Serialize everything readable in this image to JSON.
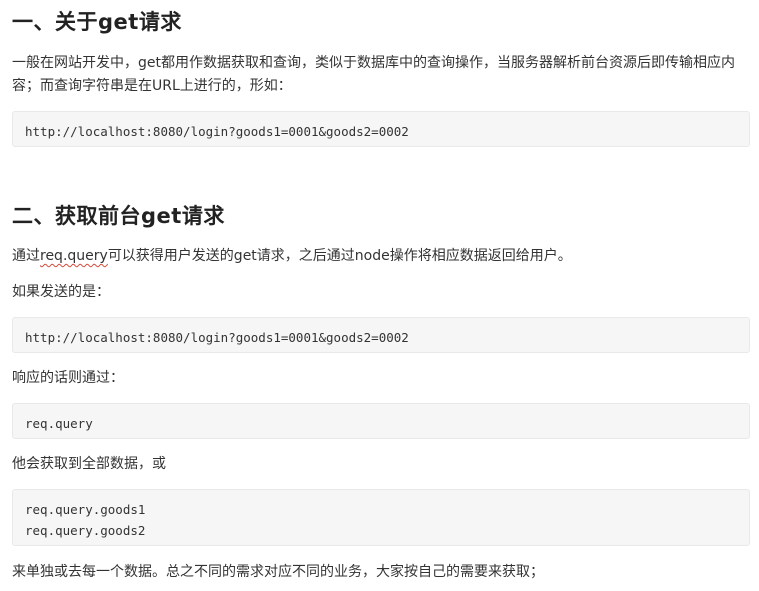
{
  "section1": {
    "heading": "一、关于get请求",
    "paragraph": "一般在网站开发中，get都用作数据获取和查询，类似于数据库中的查询操作，当服务器解析前台资源后即传输相应内容；而查询字符串是在URL上进行的，形如：",
    "code": "http://localhost:8080/login?goods1=0001&goods2=0002"
  },
  "section2": {
    "heading": "二、获取前台get请求",
    "intro_before": "通过",
    "intro_term": "req.query",
    "intro_after": "可以获得用户发送的get请求，之后通过node操作将相应数据返回给用户。",
    "if_sent": "如果发送的是：",
    "code_url": "http://localhost:8080/login?goods1=0001&goods2=0002",
    "response_text": "响应的话则通过：",
    "code_query": "req.query",
    "all_data_text": "他会获取到全部数据，或",
    "code_lines": [
      "req.query.goods1",
      "req.query.goods2"
    ],
    "closing": "来单独或去每一个数据。总之不同的需求对应不同的业务，大家按自己的需要来获取；"
  }
}
